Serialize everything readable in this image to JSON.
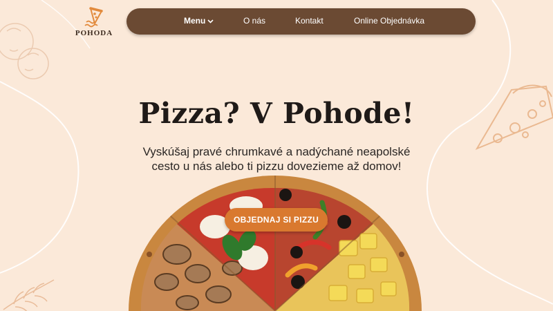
{
  "brand": {
    "name": "POHODA",
    "logo_icon": "pizza-slice-icon",
    "accent": "#e28a3c"
  },
  "nav": {
    "items": [
      {
        "label": "Menu",
        "icon": "chevron-down-icon"
      },
      {
        "label": "O nás"
      },
      {
        "label": "Kontakt"
      },
      {
        "label": "Online Objednávka"
      }
    ],
    "background": "#6b4a33"
  },
  "hero": {
    "title": "Pizza? V Pohode!",
    "subtitle": "Vyskúšaj pravé chrumkavé a nadýchané neapolské cesto u nás alebo ti pizzu dovezieme až domov!",
    "cta_label": "OBJEDNAJ SI PIZZU",
    "cta_color": "#d9792f",
    "image": "pizza-four-seasons"
  },
  "page": {
    "background": "#fbe9d9"
  }
}
